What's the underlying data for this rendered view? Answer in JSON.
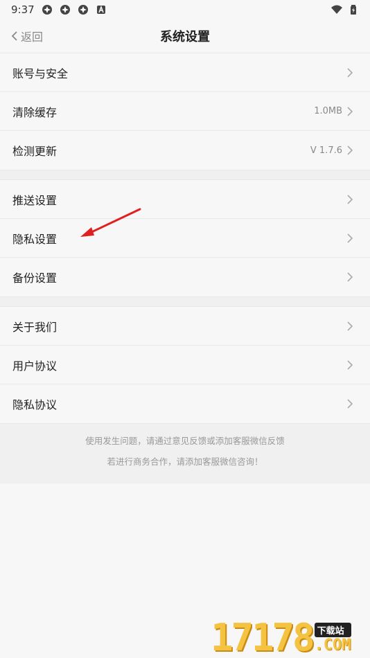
{
  "status_bar": {
    "time": "9:37",
    "icons": [
      "app-icon",
      "app-icon",
      "app-icon",
      "a-badge-icon"
    ],
    "right_icons": [
      "wifi-icon",
      "battery-icon"
    ]
  },
  "nav": {
    "back_label": "返回",
    "title": "系统设置"
  },
  "groups": [
    [
      {
        "label": "账号与安全",
        "value": ""
      },
      {
        "label": "清除缓存",
        "value": "1.0MB"
      },
      {
        "label": "检测更新",
        "value": "V 1.7.6"
      }
    ],
    [
      {
        "label": "推送设置",
        "value": ""
      },
      {
        "label": "隐私设置",
        "value": ""
      },
      {
        "label": "备份设置",
        "value": ""
      }
    ],
    [
      {
        "label": "关于我们",
        "value": ""
      },
      {
        "label": "用户协议",
        "value": ""
      },
      {
        "label": "隐私协议",
        "value": ""
      }
    ]
  ],
  "footer": {
    "line1": "使用发生问题，请通过意见反馈或添加客服微信反馈",
    "line2": "若进行商务合作，请添加客服微信咨询！"
  },
  "watermark": {
    "number": "17178",
    "tag": "下载站",
    "suffix": ".COM"
  },
  "colors": {
    "annotation_arrow": "#e02020",
    "watermark_gold": "#f5c342"
  }
}
